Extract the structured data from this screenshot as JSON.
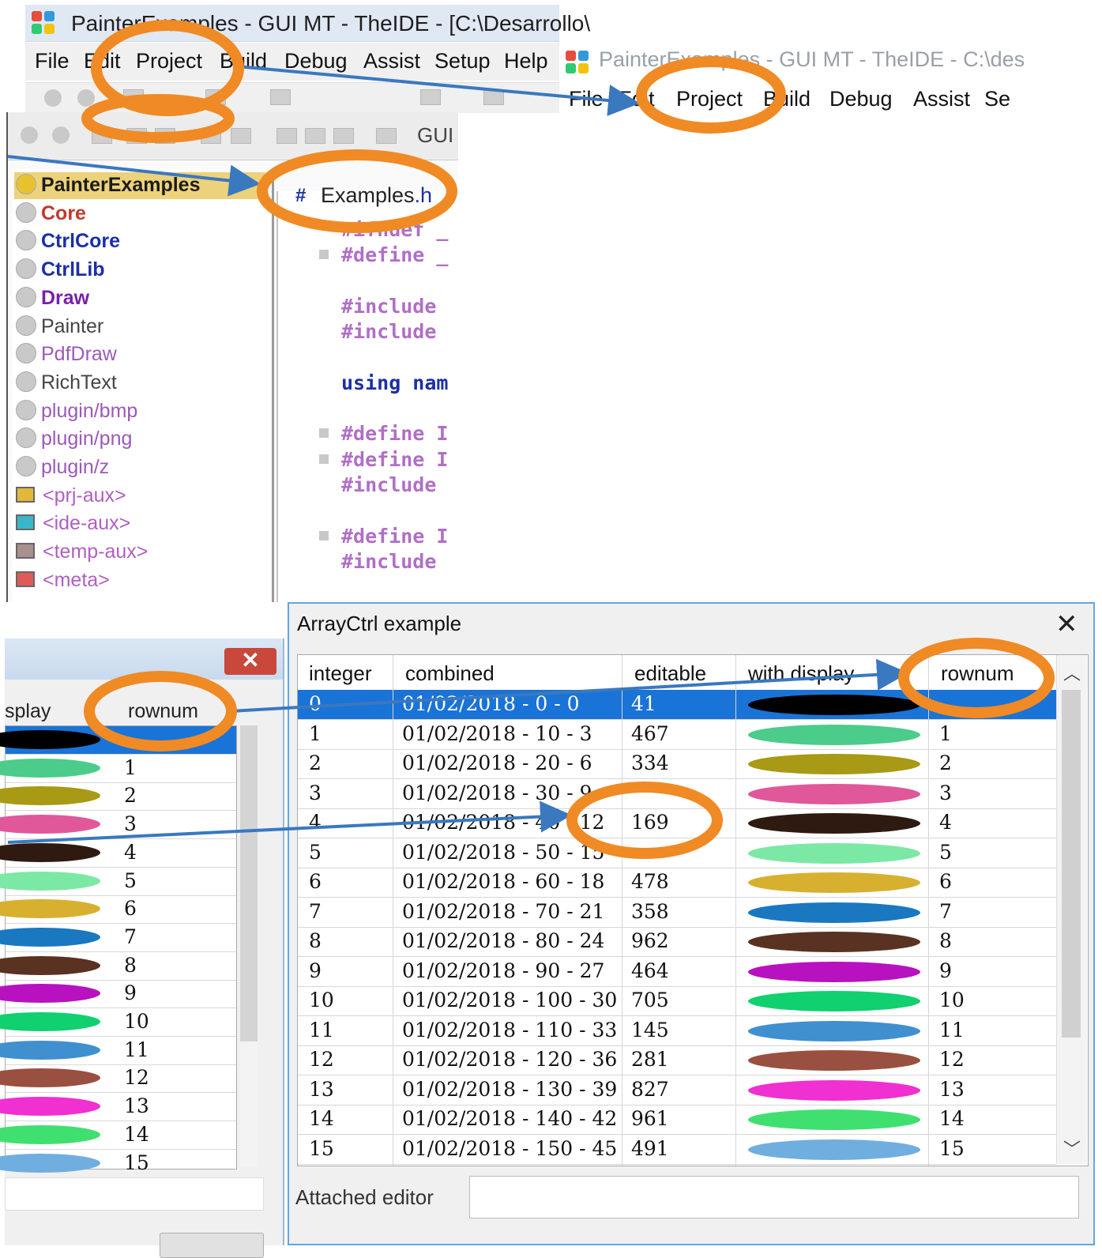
{
  "ide_top": {
    "title": "PainterExamples - GUI MT - TheIDE - [C:\\Desarrollo\\",
    "menu": [
      "File",
      "Edit",
      "Project",
      "Build",
      "Debug",
      "Assist",
      "Setup",
      "Help"
    ]
  },
  "ide_right": {
    "title": "PainterExamples - GUI MT - TheIDE - C:\\des",
    "menu": [
      "File",
      "Edit",
      "Project",
      "Build",
      "Debug",
      "Assist",
      "Se"
    ]
  },
  "workspace": {
    "toolbar_gui_label": "GUI",
    "packages": [
      {
        "name": "PainterExamples",
        "color": "#1b1b1b",
        "bold": true
      },
      {
        "name": "Core",
        "color": "#c0392b",
        "bold": true
      },
      {
        "name": "CtrlCore",
        "color": "#1b2fa6",
        "bold": true
      },
      {
        "name": "CtrlLib",
        "color": "#1b2fa6",
        "bold": true
      },
      {
        "name": "Draw",
        "color": "#7a1fa8",
        "bold": true
      },
      {
        "name": "Painter",
        "color": "#444444",
        "bold": false
      },
      {
        "name": "PdfDraw",
        "color": "#9b59b6",
        "bold": false
      },
      {
        "name": "RichText",
        "color": "#444444",
        "bold": false
      },
      {
        "name": "plugin/bmp",
        "color": "#9b59b6",
        "bold": false
      },
      {
        "name": "plugin/png",
        "color": "#9b59b6",
        "bold": false
      },
      {
        "name": "plugin/z",
        "color": "#9b59b6",
        "bold": false
      },
      {
        "name": "<prj-aux>",
        "color": "#b060c0",
        "bold": false,
        "box": "#e2b83a"
      },
      {
        "name": "<ide-aux>",
        "color": "#b060c0",
        "bold": false,
        "box": "#3ab6c6"
      },
      {
        "name": "<temp-aux>",
        "color": "#b060c0",
        "bold": false,
        "box": "#a89090"
      },
      {
        "name": "<meta>",
        "color": "#b060c0",
        "bold": false,
        "box": "#e05a5a"
      }
    ],
    "file_tab": {
      "hash": "#",
      "name": "Examples",
      "ext": ".h"
    },
    "code_lines": [
      {
        "text": "#ifndef _",
        "cls": "pre",
        "fold": false
      },
      {
        "text": "#define _",
        "cls": "pre",
        "fold": true
      },
      {
        "text": "",
        "cls": "pre",
        "fold": false
      },
      {
        "text": "#include",
        "cls": "pre",
        "fold": false
      },
      {
        "text": "#include",
        "cls": "pre",
        "fold": false
      },
      {
        "text": "",
        "cls": "pre",
        "fold": false
      },
      {
        "text": "using nam",
        "cls": "kw",
        "fold": false
      },
      {
        "text": "",
        "cls": "pre",
        "fold": false
      },
      {
        "text": "#define I",
        "cls": "pre",
        "fold": true
      },
      {
        "text": "#define I",
        "cls": "pre",
        "fold": true
      },
      {
        "text": "#include",
        "cls": "pre",
        "fold": false
      },
      {
        "text": "",
        "cls": "pre",
        "fold": false
      },
      {
        "text": "#define I",
        "cls": "pre",
        "fold": true
      },
      {
        "text": "#include",
        "cls": "pre",
        "fold": false
      }
    ]
  },
  "dialog_back": {
    "close_glyph": "✕",
    "col_display": "splay",
    "col_rownum": "rownum",
    "rows": [
      {
        "num": "",
        "color": "#000000"
      },
      {
        "num": "1",
        "color": "#4ccc8a"
      },
      {
        "num": "2",
        "color": "#a89a14"
      },
      {
        "num": "3",
        "color": "#e0589a"
      },
      {
        "num": "4",
        "color": "#2f1a12"
      },
      {
        "num": "5",
        "color": "#7ce8a6"
      },
      {
        "num": "6",
        "color": "#d8b030"
      },
      {
        "num": "7",
        "color": "#1a78c0"
      },
      {
        "num": "8",
        "color": "#5a3222"
      },
      {
        "num": "9",
        "color": "#b812c0"
      },
      {
        "num": "10",
        "color": "#10d070"
      },
      {
        "num": "11",
        "color": "#4090d0"
      },
      {
        "num": "12",
        "color": "#9a5040"
      },
      {
        "num": "13",
        "color": "#f030d0"
      },
      {
        "num": "14",
        "color": "#40e070"
      },
      {
        "num": "15",
        "color": "#70aee0"
      }
    ]
  },
  "dialog": {
    "title": "ArrayCtrl example",
    "close_glyph": "✕",
    "columns": [
      "integer",
      "combined",
      "editable",
      "with display",
      "rownum"
    ],
    "rows": [
      {
        "integer": "0",
        "combined": "01/02/2018 - 0 - 0",
        "editable": "41",
        "color": "#000000",
        "rownum": ""
      },
      {
        "integer": "1",
        "combined": "01/02/2018 - 10 - 3",
        "editable": "467",
        "color": "#4ccc8a",
        "rownum": "1"
      },
      {
        "integer": "2",
        "combined": "01/02/2018 - 20 - 6",
        "editable": "334",
        "color": "#a89a14",
        "rownum": "2"
      },
      {
        "integer": "3",
        "combined": "01/02/2018 - 30 - 9",
        "editable": "",
        "color": "#e0589a",
        "rownum": "3"
      },
      {
        "integer": "4",
        "combined": "01/02/2018 - 40 - 12",
        "editable": "169",
        "color": "#2f1a12",
        "rownum": "4"
      },
      {
        "integer": "5",
        "combined": "01/02/2018 - 50 - 15",
        "editable": "",
        "color": "#7ce8a6",
        "rownum": "5"
      },
      {
        "integer": "6",
        "combined": "01/02/2018 - 60 - 18",
        "editable": "478",
        "color": "#d8b030",
        "rownum": "6"
      },
      {
        "integer": "7",
        "combined": "01/02/2018 - 70 - 21",
        "editable": "358",
        "color": "#1a78c0",
        "rownum": "7"
      },
      {
        "integer": "8",
        "combined": "01/02/2018 - 80 - 24",
        "editable": "962",
        "color": "#5a3222",
        "rownum": "8"
      },
      {
        "integer": "9",
        "combined": "01/02/2018 - 90 - 27",
        "editable": "464",
        "color": "#b812c0",
        "rownum": "9"
      },
      {
        "integer": "10",
        "combined": "01/02/2018 - 100 - 30",
        "editable": "705",
        "color": "#10d070",
        "rownum": "10"
      },
      {
        "integer": "11",
        "combined": "01/02/2018 - 110 - 33",
        "editable": "145",
        "color": "#4090d0",
        "rownum": "11"
      },
      {
        "integer": "12",
        "combined": "01/02/2018 - 120 - 36",
        "editable": "281",
        "color": "#9a5040",
        "rownum": "12"
      },
      {
        "integer": "13",
        "combined": "01/02/2018 - 130 - 39",
        "editable": "827",
        "color": "#f030d0",
        "rownum": "13"
      },
      {
        "integer": "14",
        "combined": "01/02/2018 - 140 - 42",
        "editable": "961",
        "color": "#40e070",
        "rownum": "14"
      },
      {
        "integer": "15",
        "combined": "01/02/2018 - 150 - 45",
        "editable": "491",
        "color": "#70aee0",
        "rownum": "15"
      }
    ],
    "attached_editor_label": "Attached editor",
    "attached_editor_value": ""
  },
  "annotation": {
    "ring_color": "#f08a24",
    "arrow_color": "#3a78c0"
  }
}
